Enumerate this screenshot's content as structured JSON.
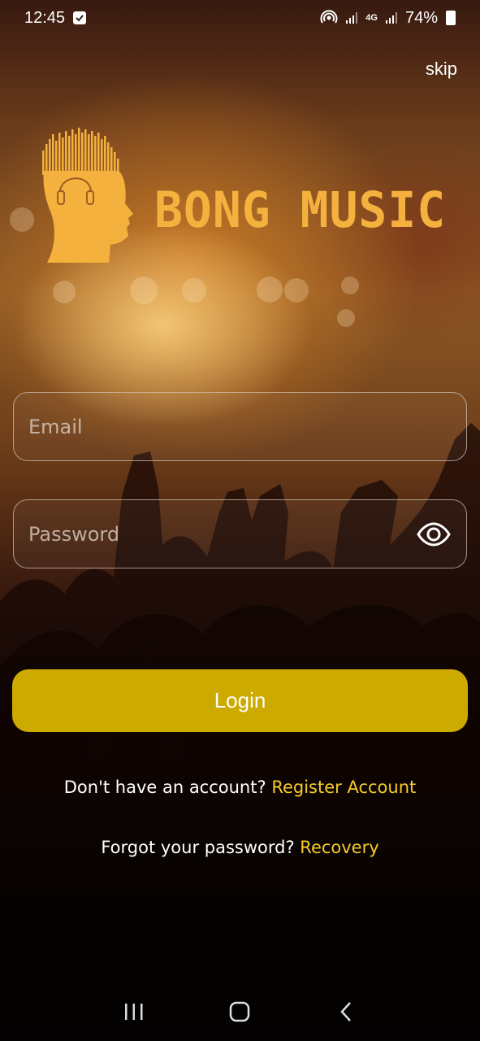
{
  "status_bar": {
    "time": "12:45",
    "network_type": "4G",
    "battery": "74%"
  },
  "skip_label": "skip",
  "brand": {
    "name": "BONG MUSIC",
    "color": "#f4b13e"
  },
  "form": {
    "email_placeholder": "Email",
    "password_placeholder": "Password",
    "login_label": "Login",
    "login_color": "#cdaa00"
  },
  "links": {
    "register_prompt": "Don't have an account?",
    "register_label": "Register Account",
    "recovery_prompt": "Forgot your password?",
    "recovery_label": "Recovery",
    "link_color": "#f6cc2a"
  },
  "icons": {
    "eye": "eye-icon",
    "check": "checkbox-icon",
    "hotspot": "hotspot-icon",
    "back": "back-icon",
    "home": "home-icon",
    "recents": "recents-icon"
  }
}
